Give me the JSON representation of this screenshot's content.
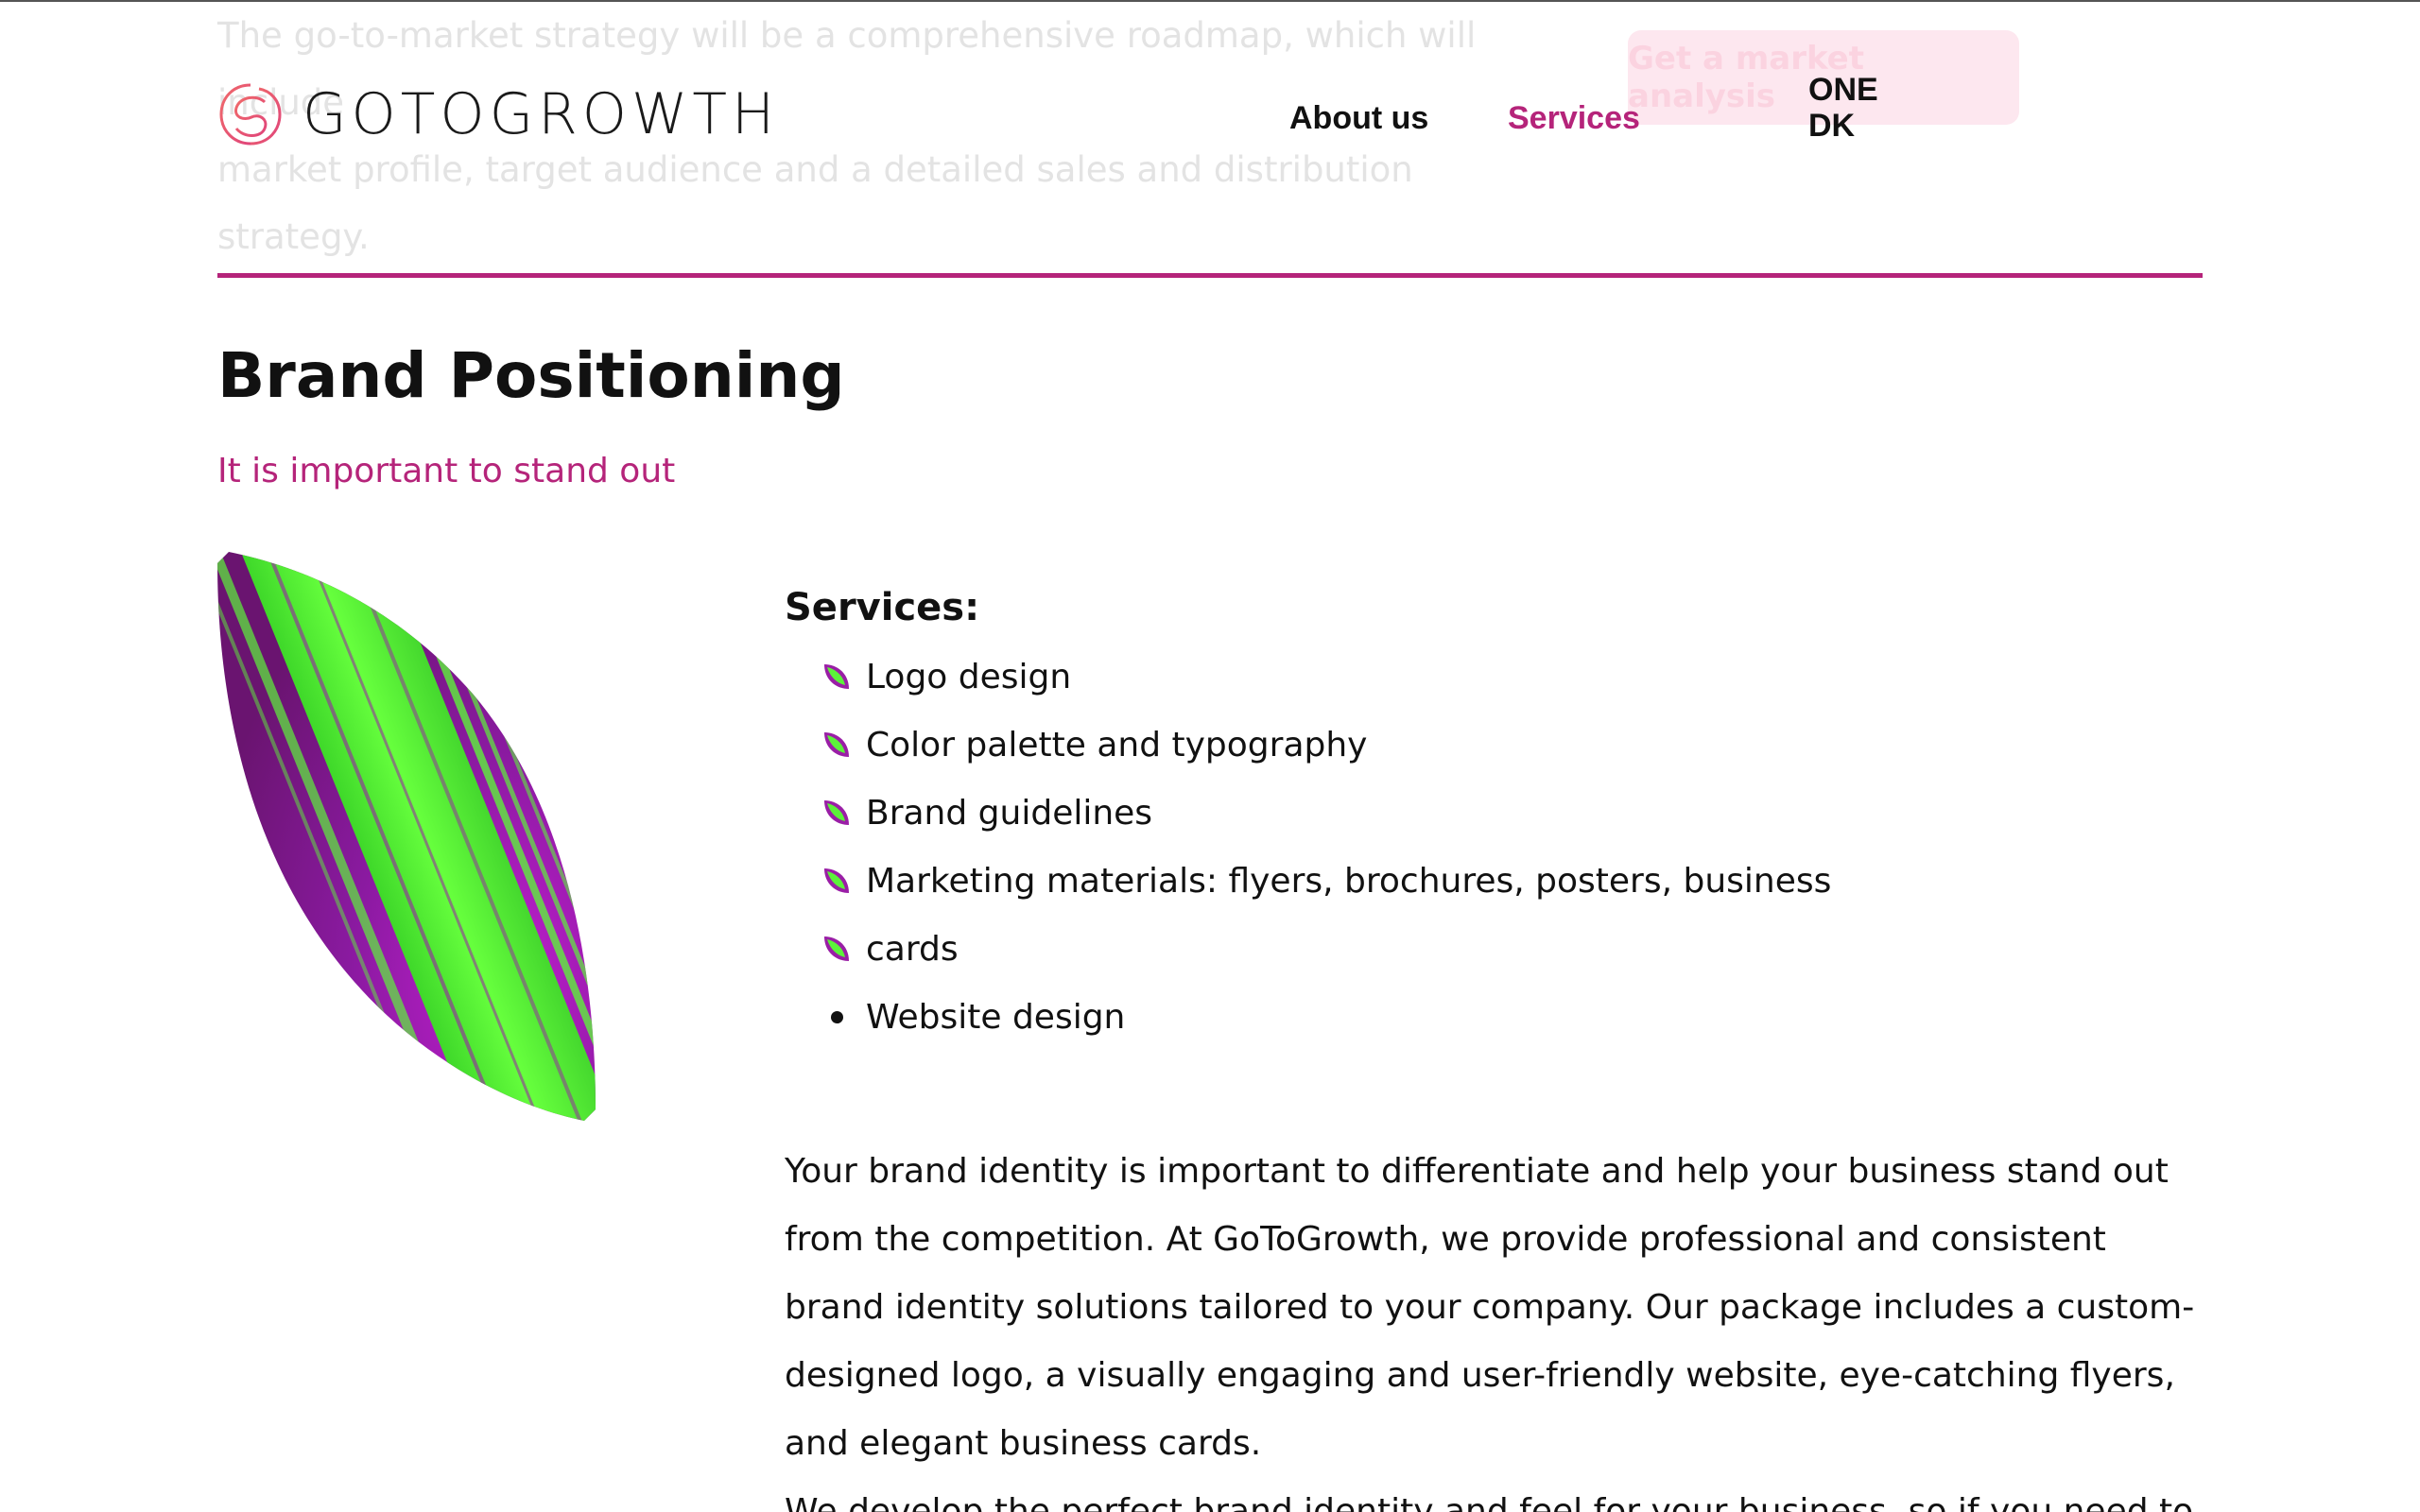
{
  "background": {
    "faded_text_line1": "The go-to-market strategy will be a comprehensive roadmap, which will include",
    "faded_text_line2": "market profile, target audience and a detailed sales and distribution strategy.",
    "faded_button_label": "Get a market analysis"
  },
  "header": {
    "logo_text": "GOTOGROWTH",
    "nav": {
      "about_label": "About us",
      "services_label": "Services",
      "language_label_line1": "ONE",
      "language_label_line2": "DK"
    }
  },
  "main": {
    "title": "Brand Positioning",
    "subtitle": "It is important to stand out",
    "services_heading": "Services:",
    "services": [
      "Logo design",
      "Color palette and typography",
      "Brand guidelines",
      "Marketing materials: flyers, brochures, posters, business",
      "cards",
      "Website design"
    ],
    "description": "Your brand identity is important to differentiate and help your business stand out from the competition. At GoToGrowth, we provide professional and consistent brand identity solutions tailored to your company. Our package includes a custom-designed logo, a visually engaging and user-friendly website, eye-catching flyers, and elegant business cards.",
    "description_cut": "We develop the perfect brand identity and feel for your business, so if you need to stand"
  },
  "colors": {
    "accent": "#b5247a",
    "leaf_green": "#5cf23a",
    "leaf_purple": "#9a1ea6"
  }
}
